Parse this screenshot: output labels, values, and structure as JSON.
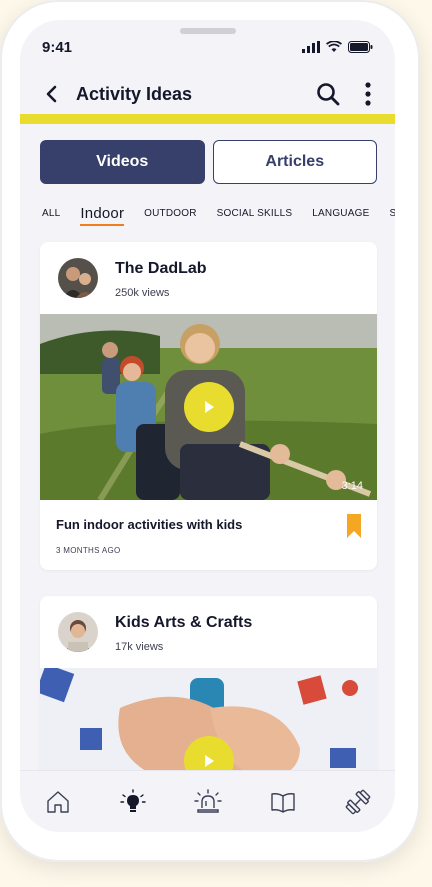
{
  "status": {
    "time": "9:41"
  },
  "header": {
    "title": "Activity Ideas"
  },
  "segments": {
    "videos": "Videos",
    "articles": "Articles"
  },
  "filters": [
    "ALL",
    "Indoor",
    "OUTDOOR",
    "SOCIAL SKILLS",
    "LANGUAGE",
    "ST"
  ],
  "cards": [
    {
      "channel": "The DadLab",
      "views": "250k views",
      "duration": "3:14",
      "title": "Fun indoor activities with kids",
      "date": "3 MONTHS AGO"
    },
    {
      "channel": "Kids Arts & Crafts",
      "views": "17k views"
    }
  ],
  "tabbar": {
    "icons": [
      "home-icon",
      "lightbulb-icon",
      "alarm-icon",
      "book-icon",
      "dumbbell-icon"
    ]
  },
  "colors": {
    "accent_yellow": "#e8dc2f",
    "navy": "#37406a",
    "bookmark_orange": "#f5a623",
    "underline_orange": "#f07d1f"
  }
}
